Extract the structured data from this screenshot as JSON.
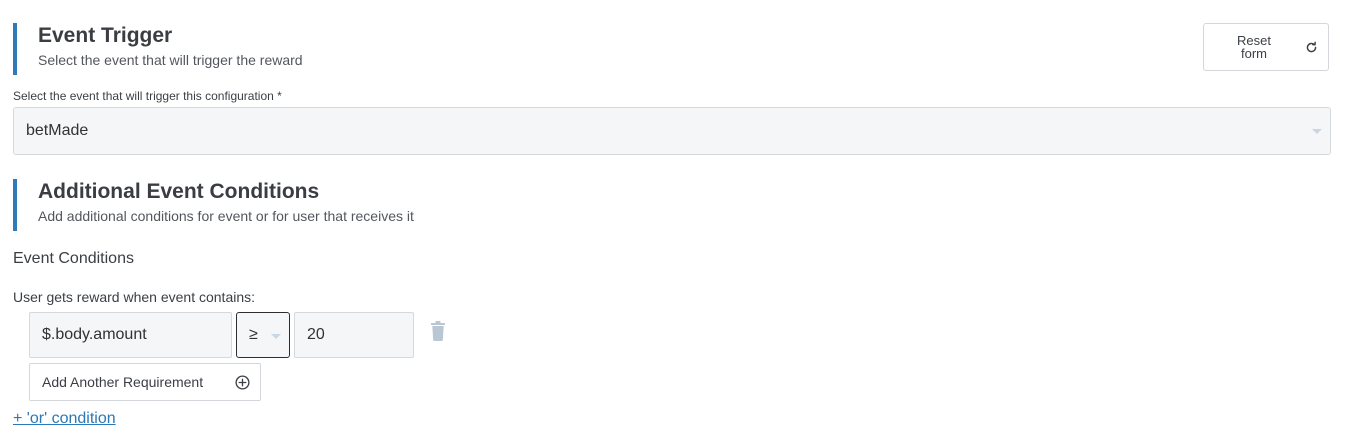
{
  "event_trigger": {
    "title": "Event Trigger",
    "subtitle": "Select the event that will trigger the reward",
    "reset_label": "Reset form",
    "field_label": "Select the event that will trigger this configuration *",
    "selected_event": "betMade"
  },
  "additional_conditions": {
    "title": "Additional Event Conditions",
    "subtitle": "Add additional conditions for event or for user that receives it",
    "subheading": "Event Conditions",
    "contains_label": "User gets reward when event contains:",
    "conditions": [
      {
        "field": "$.body.amount",
        "operator": "≥",
        "value": "20"
      }
    ],
    "add_requirement_label": "Add Another Requirement",
    "or_condition_label": "+ 'or' condition"
  },
  "colors": {
    "accent": "#2f7ab8",
    "link": "#2a78b8",
    "input_bg": "#f5f6f7",
    "trash": "#b9c6d3"
  },
  "icons": {
    "reset": "refresh-icon",
    "dropdown": "chevron-down-icon",
    "delete": "trash-icon",
    "add": "plus-circle-icon"
  }
}
